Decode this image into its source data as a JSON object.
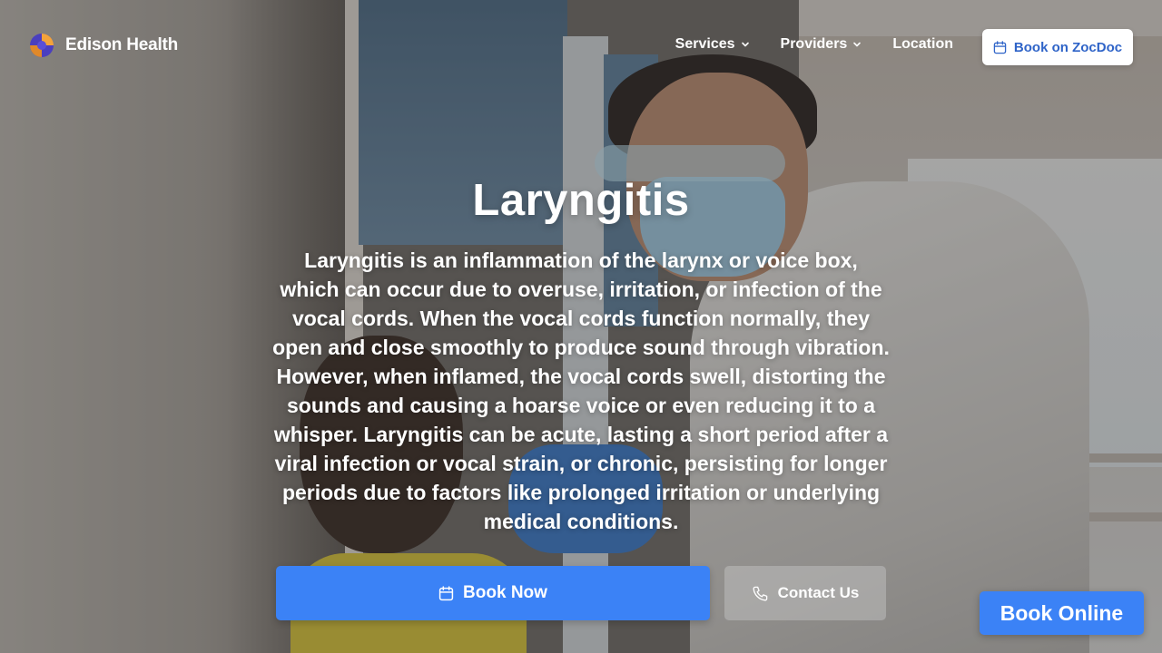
{
  "brand": {
    "name": "Edison Health",
    "logo_icon": "edison-health-logo"
  },
  "nav": {
    "items": [
      {
        "label": "Services",
        "has_dropdown": true
      },
      {
        "label": "Providers",
        "has_dropdown": true
      },
      {
        "label": "Location",
        "has_dropdown": false
      }
    ],
    "zocdoc_label": "Book on ZocDoc",
    "zocdoc_icon": "calendar-icon"
  },
  "hero": {
    "title": "Laryngitis",
    "description": "Laryngitis is an inflammation of the larynx or voice box, which can occur due to overuse, irritation, or infection of the vocal cords. When the vocal cords function normally, they open and close smoothly to produce sound through vibration. However, when inflamed, the vocal cords swell, distorting the sounds and causing a hoarse voice or even reducing it to a whisper. Laryngitis can be acute, lasting a short period after a viral infection or vocal strain, or chronic, persisting for longer periods due to factors like prolonged irritation or underlying medical conditions.",
    "book_now_label": "Book Now",
    "contact_label": "Contact Us"
  },
  "floating": {
    "book_online_label": "Book Online"
  },
  "colors": {
    "primary": "#3b82f6",
    "zocdoc_text": "#2f64c8"
  }
}
